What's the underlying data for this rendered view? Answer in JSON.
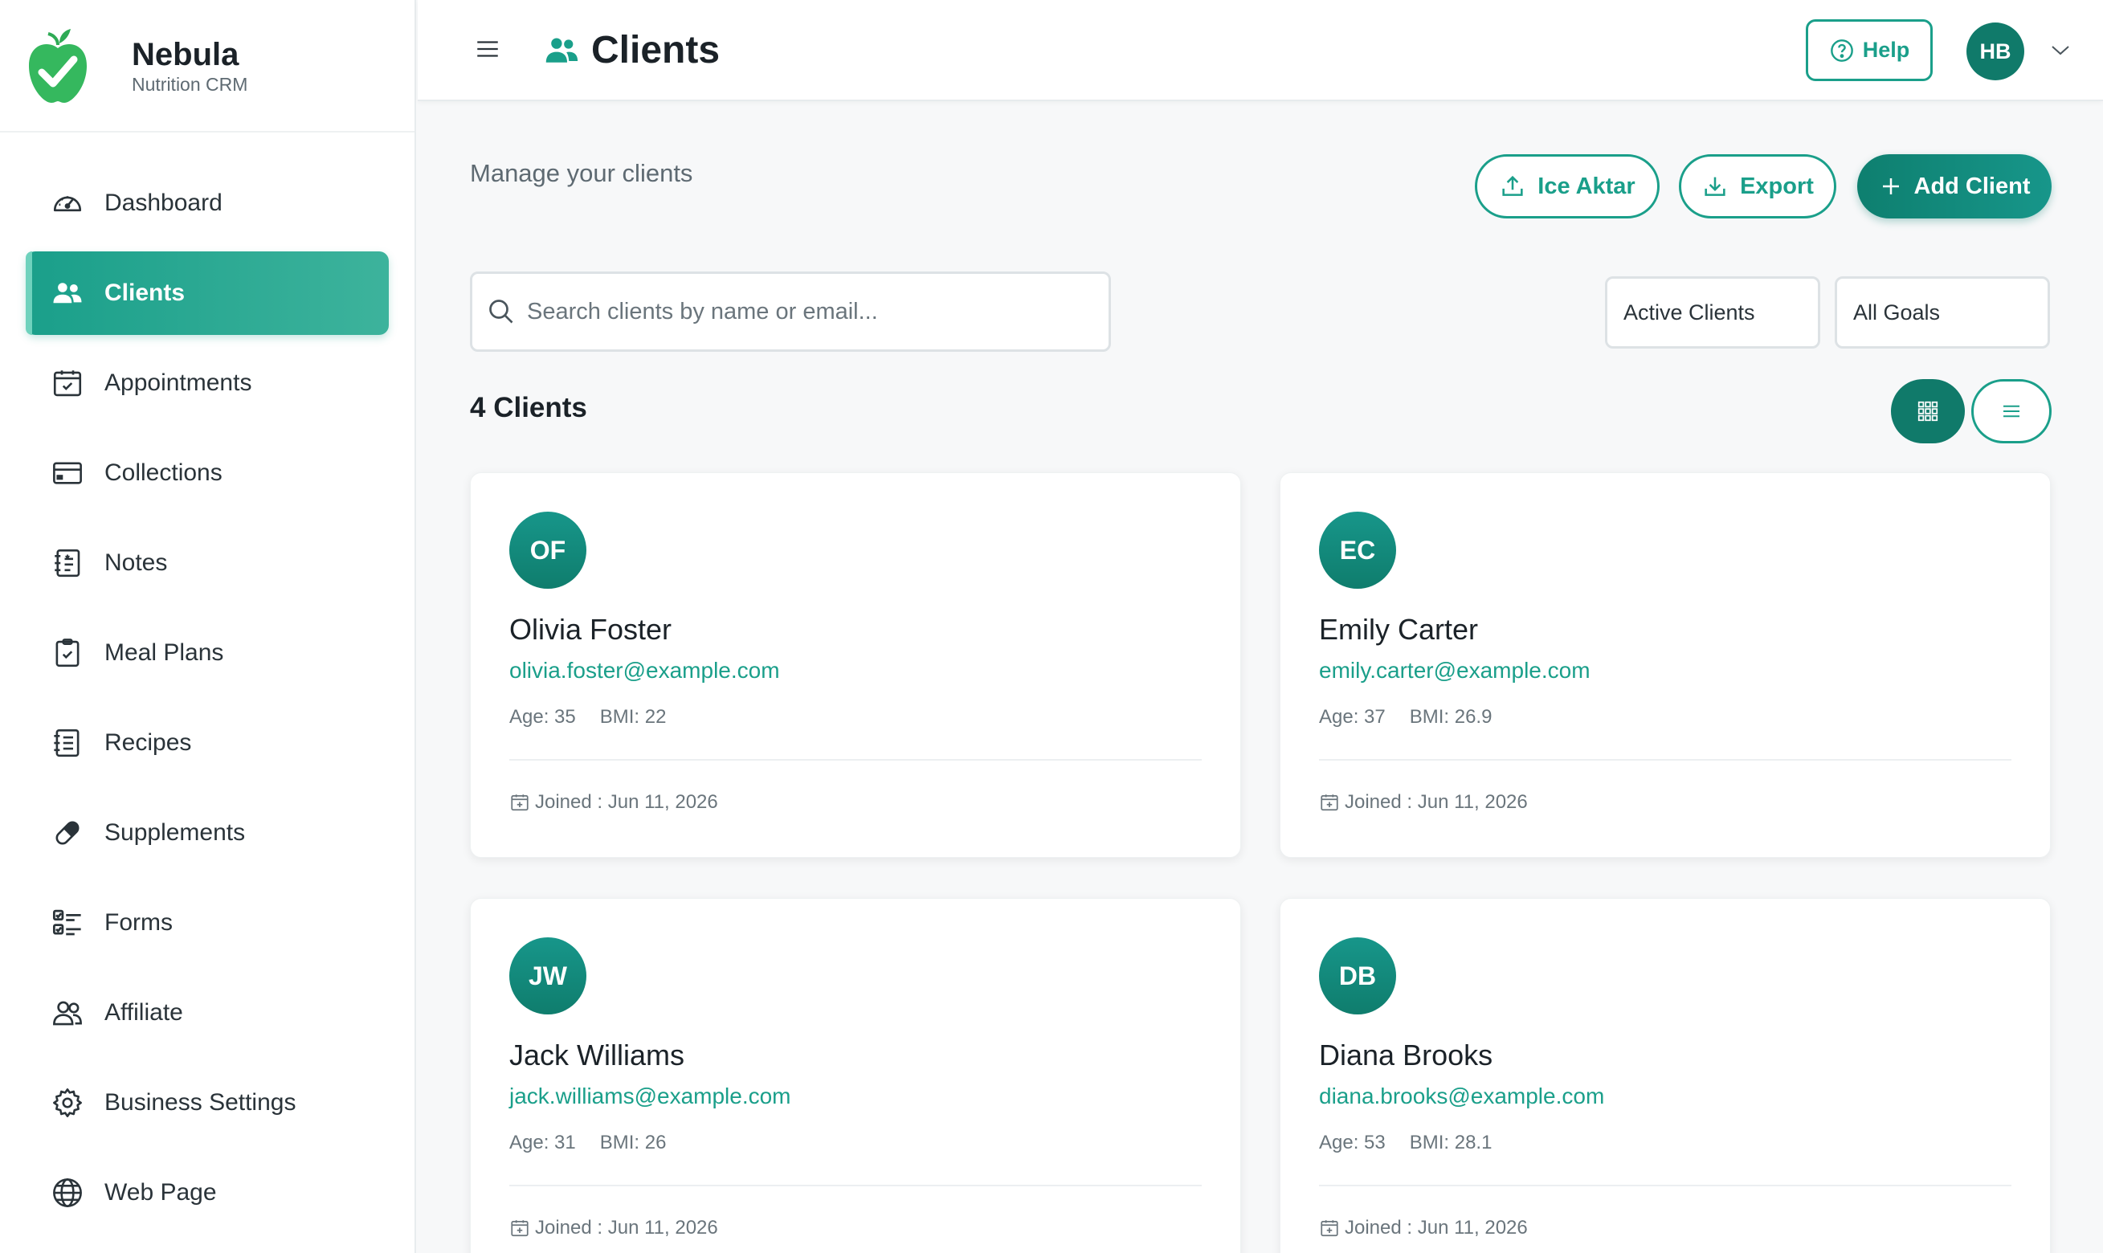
{
  "brand": {
    "name": "Nebula",
    "subtitle": "Nutrition CRM"
  },
  "colors": {
    "primary": "#1a9f8a",
    "primary_dark": "#107a6a",
    "accent_light": "#6fd2bd"
  },
  "sidebar": {
    "items": [
      {
        "label": "Dashboard",
        "icon": "speedometer-icon",
        "active": false
      },
      {
        "label": "Clients",
        "icon": "users-icon",
        "active": true
      },
      {
        "label": "Appointments",
        "icon": "calendar-check-icon",
        "active": false
      },
      {
        "label": "Collections",
        "icon": "credit-card-icon",
        "active": false
      },
      {
        "label": "Notes",
        "icon": "notebook-icon",
        "active": false
      },
      {
        "label": "Meal Plans",
        "icon": "clipboard-check-icon",
        "active": false
      },
      {
        "label": "Recipes",
        "icon": "list-document-icon",
        "active": false
      },
      {
        "label": "Supplements",
        "icon": "capsule-icon",
        "active": false
      },
      {
        "label": "Forms",
        "icon": "checklist-icon",
        "active": false
      },
      {
        "label": "Affiliate",
        "icon": "people-outline-icon",
        "active": false
      },
      {
        "label": "Business Settings",
        "icon": "gear-icon",
        "active": false
      },
      {
        "label": "Web Page",
        "icon": "globe-icon",
        "active": false
      }
    ]
  },
  "header": {
    "title": "Clients",
    "help_label": "Help",
    "user_initials": "HB"
  },
  "main": {
    "subtitle": "Manage your clients",
    "import_label": "Ice Aktar",
    "export_label": "Export",
    "add_label": "Add Client",
    "search_placeholder": "Search clients by name or email...",
    "status_filter": "Active Clients",
    "goal_filter": "All Goals",
    "count_label": "4 Clients",
    "view_mode": "grid"
  },
  "clients": [
    {
      "initials": "OF",
      "name": "Olivia Foster",
      "email": "olivia.foster@example.com",
      "age": "Age: 35",
      "bmi": "BMI: 22",
      "joined": "Joined : Jun 11, 2026"
    },
    {
      "initials": "EC",
      "name": "Emily Carter",
      "email": "emily.carter@example.com",
      "age": "Age: 37",
      "bmi": "BMI: 26.9",
      "joined": "Joined : Jun 11, 2026"
    },
    {
      "initials": "JW",
      "name": "Jack Williams",
      "email": "jack.williams@example.com",
      "age": "Age: 31",
      "bmi": "BMI: 26",
      "joined": "Joined : Jun 11, 2026"
    },
    {
      "initials": "DB",
      "name": "Diana Brooks",
      "email": "diana.brooks@example.com",
      "age": "Age: 53",
      "bmi": "BMI: 28.1",
      "joined": "Joined : Jun 11, 2026"
    }
  ]
}
